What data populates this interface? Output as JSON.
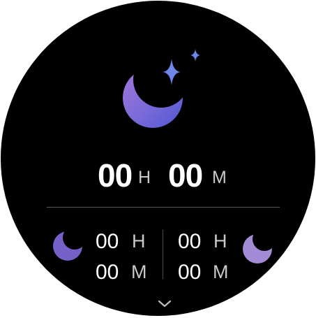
{
  "total_sleep": {
    "hours_value": "00",
    "hours_unit": "H",
    "minutes_value": "00",
    "minutes_unit": "M"
  },
  "left_stat": {
    "icon": "moon-icon",
    "hours_value": "00",
    "hours_unit": "H",
    "minutes_value": "00",
    "minutes_unit": "M"
  },
  "right_stat": {
    "icon": "moon-icon",
    "hours_value": "00",
    "hours_unit": "H",
    "minutes_value": "00",
    "minutes_unit": "M"
  },
  "header_icon": "moon-stars-icon",
  "footer_icon": "chevron-down-icon",
  "colors": {
    "moon_gradient_top": "#8d7ee0",
    "moon_gradient_bottom": "#5a58d6",
    "stars": "#7c85e8",
    "left_moon": "#7863c6",
    "right_moon": "#a88bd6",
    "divider": "#5a5a5a"
  }
}
